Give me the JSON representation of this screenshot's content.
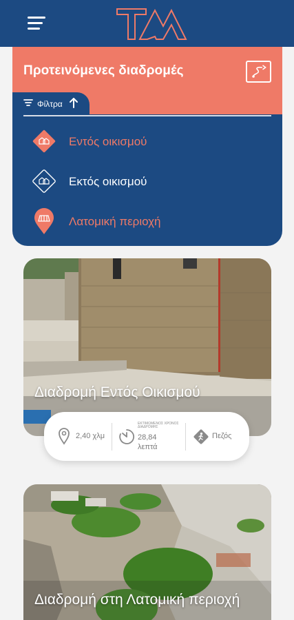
{
  "header": {
    "menu_icon": "hamburger-menu-icon",
    "logo_icon": "tm-logo-icon"
  },
  "panel": {
    "title": "Προτεινόμενες διαδρομές",
    "route_icon": "route-map-icon",
    "filter_label": "Φίλτρα",
    "filter_icon": "filter-funnel-icon",
    "sort_icon": "arrow-up-icon",
    "options": [
      {
        "label": "Εντός οικισμού",
        "icon": "village-house-diamond-icon",
        "color": "#ef7a67",
        "active": true
      },
      {
        "label": "Εκτός οικισμού",
        "icon": "house-outline-diamond-icon",
        "color": "#ffffff",
        "active": false
      },
      {
        "label": "Λατομική περιοχή",
        "icon": "quarry-pin-icon",
        "color": "#ef7a67",
        "active": true
      }
    ]
  },
  "cards": [
    {
      "title": "Διαδρομή Εντός Οικισμού",
      "distance": "2,40 χλμ",
      "time_caption": "ΕΚΤΙΜΩΜΕΝΟΣ ΧΡΟΝΟΣ ΔΙΑΔΡΟΜΗΣ",
      "time_value": "28,84",
      "time_unit": "λεπτά",
      "mode": "Πεζός"
    },
    {
      "title": "Διαδρομή στη Λατομική περιοχή"
    }
  ],
  "colors": {
    "primary_blue": "#1c4a82",
    "coral": "#ef7a67",
    "background": "#f3f3f3"
  }
}
